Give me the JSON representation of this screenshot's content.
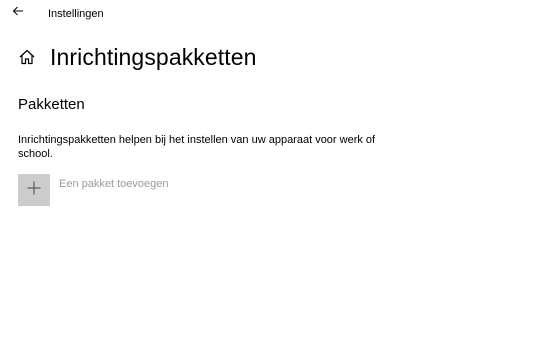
{
  "window": {
    "app_title": "Instellingen"
  },
  "header": {
    "title": "Inrichtingspakketten",
    "home_icon": "home-icon",
    "back_icon": "back-arrow-icon"
  },
  "section": {
    "title": "Pakketten",
    "description": "Inrichtingspakketten helpen bij het instellen van uw apparaat voor werk of school."
  },
  "add_package": {
    "label": "Een pakket toevoegen",
    "icon": "plus-icon",
    "enabled": false
  },
  "colors": {
    "background": "#ffffff",
    "text": "#000000",
    "disabled_text": "#9a9a9a",
    "tile_background": "#cccccc"
  }
}
